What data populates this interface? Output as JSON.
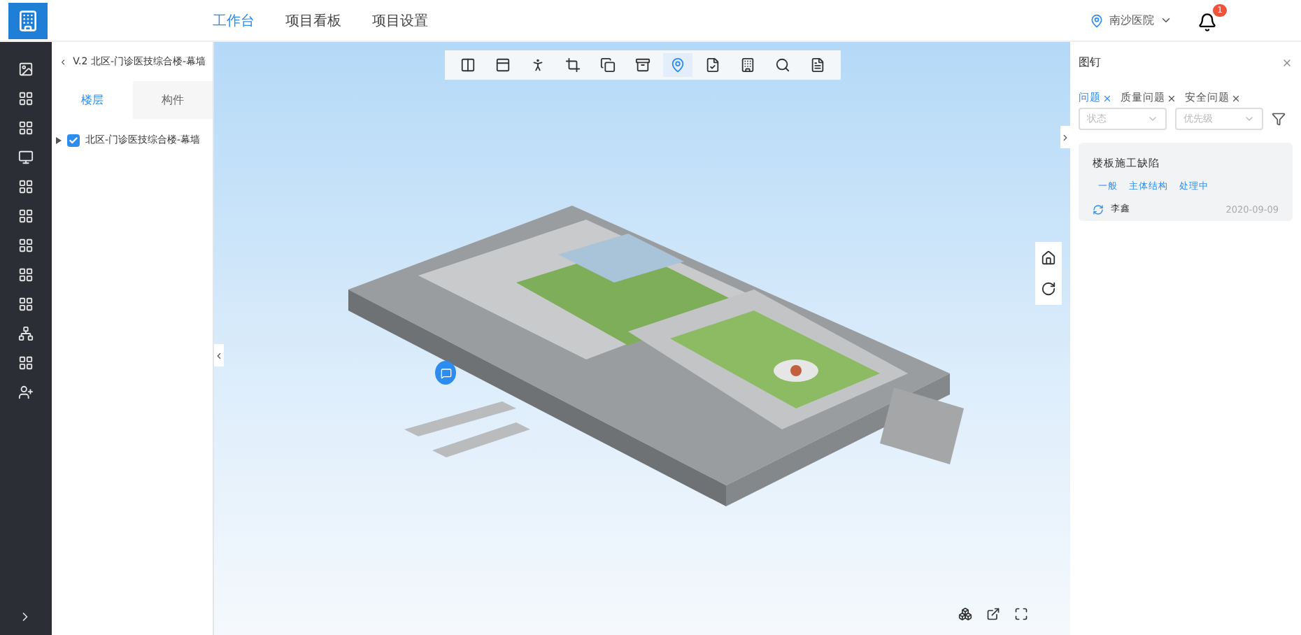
{
  "nav": {
    "items": [
      {
        "label": "工作台",
        "selected": true
      },
      {
        "label": "项目看板",
        "selected": false
      },
      {
        "label": "项目设置",
        "selected": false
      }
    ],
    "location": "南沙医院",
    "notifications": "1"
  },
  "left_panel": {
    "title": "V.2 北区-门诊医技综合楼-幕墙",
    "tabs": [
      {
        "label": "楼层",
        "selected": true
      },
      {
        "label": "构件",
        "selected": false
      }
    ],
    "tree": [
      {
        "label": "北区-门诊医技综合楼-幕墙",
        "checked": true,
        "expanded": false
      }
    ]
  },
  "toolbar": [
    {
      "selected": false
    },
    {
      "selected": false
    },
    {
      "selected": false
    },
    {
      "selected": false
    },
    {
      "selected": false
    },
    {
      "selected": false
    },
    {
      "selected": true
    },
    {
      "selected": false
    },
    {
      "selected": false
    },
    {
      "selected": false
    },
    {
      "selected": false
    }
  ],
  "right_panel": {
    "title": "图钉",
    "filters": [
      {
        "label": "问题",
        "selected": true
      },
      {
        "label": "质量问题",
        "selected": false
      },
      {
        "label": "安全问题",
        "selected": false
      }
    ],
    "selects": [
      {
        "placeholder": "状态"
      },
      {
        "placeholder": "优先级"
      }
    ],
    "cards": [
      {
        "title": "楼板施工缺陷",
        "tags": [
          "一般",
          "主体结构",
          "处理中"
        ],
        "user": "李鑫",
        "date": "2020-09-09"
      }
    ]
  }
}
